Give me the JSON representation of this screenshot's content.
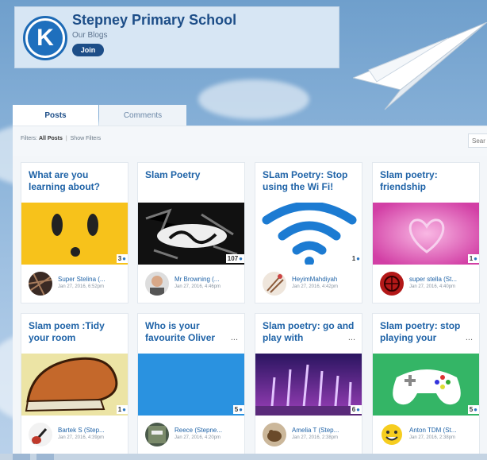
{
  "school": {
    "name": "Stepney Primary School",
    "subtitle": "Our Blogs",
    "join_label": "Join",
    "logo_letter": "K"
  },
  "tabs": [
    {
      "label": "Posts",
      "active": true
    },
    {
      "label": "Comments",
      "active": false
    }
  ],
  "filters": {
    "prefix": "Filters:",
    "selected": "All Posts",
    "show_filters": "Show Filters"
  },
  "search": {
    "placeholder": "Sear"
  },
  "colors": {
    "brand_blue": "#1d4e88",
    "title_blue": "#1f63a7",
    "comment_icon_blue": "#2c77c1"
  },
  "posts": [
    {
      "title": "What are you learning about?",
      "comments": "3",
      "author": "Super Stelina (...",
      "date": "Jan 27, 2016, 6:52pm",
      "image": "yellow-face",
      "avatar": "dark-abstract"
    },
    {
      "title": "Slam Poetry",
      "comments": "107",
      "author": "Mr Browning (...",
      "date": "Jan 27, 2016, 4:46pm",
      "image": "slam-logo",
      "avatar": "person-photo"
    },
    {
      "title": "SLam Poetry: Stop using the Wi Fi!",
      "comments": "1",
      "author": "HeyimMahdiyah",
      "date": "Jan 27, 2016, 4:42pm",
      "image": "wifi-symbol",
      "avatar": "paint-brushes"
    },
    {
      "title": "Slam poetry: friendship",
      "comments": "1",
      "author": "super stella (St...",
      "date": "Jan 27, 2016, 4:40pm",
      "image": "pink-heart",
      "avatar": "red-pattern"
    },
    {
      "title": "Slam poem :Tidy your room",
      "comments": "1",
      "author": "Bartek S (Step...",
      "date": "Jan 27, 2016, 4:39pm",
      "image": "cartoon-shoe",
      "avatar": "guitar"
    },
    {
      "title": "Who is your favourite Oliver",
      "comments": "5",
      "author": "Reece (Stepne...",
      "date": "Jan 27, 2016, 4:20pm",
      "image": "blue-square",
      "avatar": "game-cover"
    },
    {
      "title": "Slam poetry: go and play with",
      "comments": "6",
      "author": "Amelia T (Step...",
      "date": "Jan 27, 2016, 2:38pm",
      "image": "fountain-lights",
      "avatar": "dog-photo"
    },
    {
      "title": "Slam poetry: stop playing your",
      "comments": "5",
      "author": "Anton TDM (St...",
      "date": "Jan 27, 2016, 2:38pm",
      "image": "game-controller",
      "avatar": "smiley-face"
    }
  ]
}
